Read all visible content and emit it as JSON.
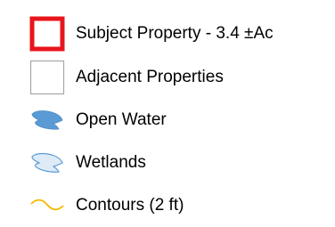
{
  "legend": {
    "items": [
      {
        "label": "Subject Property - 3.4 ±Ac",
        "icon": "red-outline-square-icon",
        "color": "#e8141c"
      },
      {
        "label": "Adjacent Properties",
        "icon": "gray-outline-square-icon",
        "color": "#a6a6a6"
      },
      {
        "label": "Open Water",
        "icon": "blue-fill-water-icon",
        "color": "#5b9bd5"
      },
      {
        "label": "Wetlands",
        "icon": "light-blue-outline-wetland-icon",
        "color": "#9dc3e6"
      },
      {
        "label": "Contours (2 ft)",
        "icon": "orange-wavy-line-icon",
        "color": "#f5b800"
      }
    ]
  }
}
